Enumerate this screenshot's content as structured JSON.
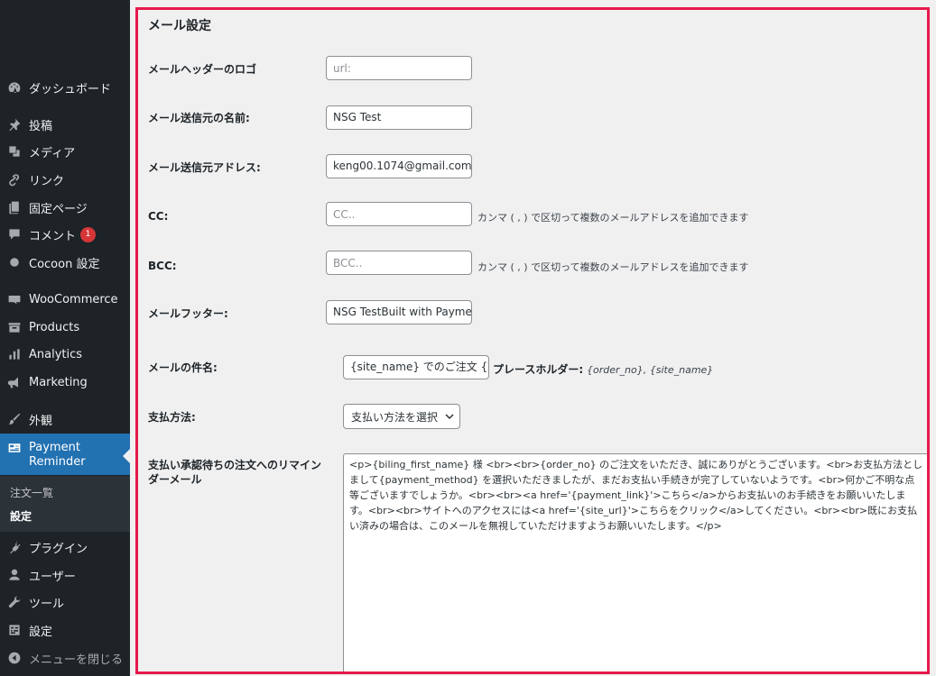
{
  "sidebar": {
    "items": [
      {
        "id": "dashboard",
        "label": "ダッシュボード",
        "icon": "dashboard-icon"
      },
      {
        "id": "posts",
        "label": "投稿",
        "icon": "pin-icon"
      },
      {
        "id": "media",
        "label": "メディア",
        "icon": "media-icon"
      },
      {
        "id": "links",
        "label": "リンク",
        "icon": "link-icon"
      },
      {
        "id": "pages",
        "label": "固定ページ",
        "icon": "page-icon"
      },
      {
        "id": "comments",
        "label": "コメント",
        "icon": "comment-icon",
        "badge": "1"
      },
      {
        "id": "cocoon",
        "label": "Cocoon 設定",
        "icon": "circle-icon"
      },
      {
        "id": "woocommerce",
        "label": "WooCommerce",
        "icon": "woo-icon"
      },
      {
        "id": "products",
        "label": "Products",
        "icon": "archive-icon"
      },
      {
        "id": "analytics",
        "label": "Analytics",
        "icon": "bar-chart-icon"
      },
      {
        "id": "marketing",
        "label": "Marketing",
        "icon": "megaphone-icon"
      },
      {
        "id": "appearance",
        "label": "外観",
        "icon": "brush-icon"
      },
      {
        "id": "payment-reminder",
        "label": "Payment Reminder",
        "icon": "card-icon"
      },
      {
        "id": "plugins",
        "label": "プラグイン",
        "icon": "plugin-icon"
      },
      {
        "id": "users",
        "label": "ユーザー",
        "icon": "user-icon"
      },
      {
        "id": "tools",
        "label": "ツール",
        "icon": "wrench-icon"
      },
      {
        "id": "settings",
        "label": "設定",
        "icon": "settings-icon"
      },
      {
        "id": "collapse",
        "label": "メニューを閉じる",
        "icon": "collapse-icon"
      }
    ],
    "submenu": [
      {
        "label": "注文一覧",
        "current": false
      },
      {
        "label": "設定",
        "current": true
      }
    ]
  },
  "form": {
    "section_title": "メール設定",
    "header_logo": {
      "label": "メールヘッダーのロゴ",
      "placeholder": "url:"
    },
    "sender_name": {
      "label": "メール送信元の名前:",
      "value": "NSG Test"
    },
    "sender_address": {
      "label": "メール送信元アドレス:",
      "value": "keng00.1074@gmail.com"
    },
    "cc": {
      "label": "CC:",
      "placeholder": "CC..",
      "hint": "カンマ ( , ) で区切って複数のメールアドレスを追加できます"
    },
    "bcc": {
      "label": "BCC:",
      "placeholder": "BCC..",
      "hint": "カンマ ( , ) で区切って複数のメールアドレスを追加できます"
    },
    "footer": {
      "label": "メールフッター:",
      "value": "NSG TestBuilt with Payment Reminder"
    },
    "subject": {
      "label": "メールの件名:",
      "value": "{site_name} でのご注文 {order_no}",
      "placeholder_label": "プレースホルダー:",
      "placeholder_values": "{order_no}, {site_name}"
    },
    "payment_method": {
      "label": "支払方法:",
      "selected": "支払い方法を選択"
    },
    "reminder": {
      "label": "支払い承認待ちの注文へのリマインダーメール",
      "value": "<p>{biling_first_name} 様 <br><br>{order_no} のご注文をいただき、誠にありがとうございます。<br>お支払方法としまして{payment_method} を選択いただきましたが、まだお支払い手続きが完了していないようです。<br>何かご不明な点等ございますでしょうか。<br><br><a href='{payment_link}'>こちら</a>からお支払いのお手続きをお願いいたします。<br><br>サイトへのアクセスには<a href='{site_url}'>こちらをクリック</a>してください。<br><br>既にお支払い済みの場合は、このメールを無視していただけますようお願いいたします。</p>"
    }
  },
  "colors": {
    "sidebar_bg": "#1d2327",
    "active": "#2271b1",
    "highlight_border": "#e6194b",
    "badge": "#d63638"
  }
}
